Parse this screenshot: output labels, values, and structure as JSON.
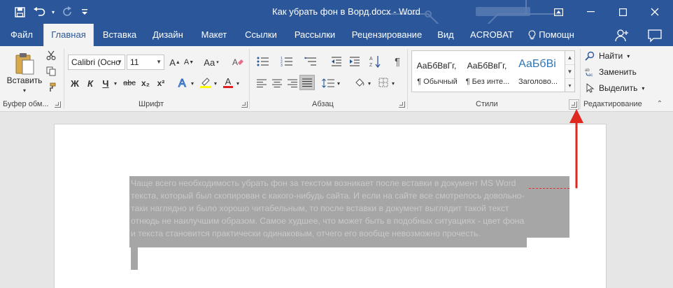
{
  "window": {
    "title": "Как убрать фон в Ворд.docx - Word",
    "controls": [
      "restore-ribbon",
      "minimize",
      "maximize",
      "close"
    ]
  },
  "qat": {
    "items": [
      "save-icon",
      "undo-icon",
      "redo-icon",
      "customize-icon"
    ]
  },
  "tabs": [
    {
      "label": "Файл"
    },
    {
      "label": "Главная"
    },
    {
      "label": "Вставка"
    },
    {
      "label": "Дизайн"
    },
    {
      "label": "Макет"
    },
    {
      "label": "Ссылки"
    },
    {
      "label": "Рассылки"
    },
    {
      "label": "Рецензирование"
    },
    {
      "label": "Вид"
    },
    {
      "label": "ACROBAT"
    },
    {
      "label": "Помощн"
    }
  ],
  "active_tab": "Главная",
  "ribbon": {
    "clipboard": {
      "label": "Буфер обм...",
      "paste": "Вставить"
    },
    "font": {
      "label": "Шрифт",
      "font_name": "Calibri (Осно",
      "font_size": "11",
      "bold": "Ж",
      "italic": "К",
      "underline": "Ч",
      "strike": "abc",
      "subscript": "x₂",
      "superscript": "x²",
      "change_case": "Aa",
      "font_color_letter": "A"
    },
    "paragraph": {
      "label": "Абзац"
    },
    "styles": {
      "label": "Стили",
      "items": [
        {
          "sample": "АаБбВвГг,",
          "name": "¶ Обычный"
        },
        {
          "sample": "АаБбВвГг,",
          "name": "¶ Без инте..."
        },
        {
          "sample": "АаБбВі",
          "name": "Заголово..."
        }
      ]
    },
    "editing": {
      "label": "Редактирование",
      "find": "Найти",
      "replace": "Заменить",
      "select": "Выделить"
    }
  },
  "document": {
    "lines": [
      "Чаще всего необходимость убрать фон за текстом возникает после вставки в документ MS Word",
      "текста, который был скопирован с какого-нибудь сайта. И если на сайте все смотрелось довольно-",
      "таки наглядно и было хорошо читабельным, то после вставки в документ выглядит такой текст",
      "отнюдь не наилучшим образом. Самое худшее, что может быть в подобных ситуациях - цвет фона",
      "и текста становится практически одинаковым, отчего его вообще невозможно прочесть."
    ]
  },
  "colors": {
    "brand": "#2b579a",
    "ribbon_bg": "#f3f3f3",
    "highlight": "#a6a6a6",
    "annotation_arrow": "#e0281f"
  }
}
